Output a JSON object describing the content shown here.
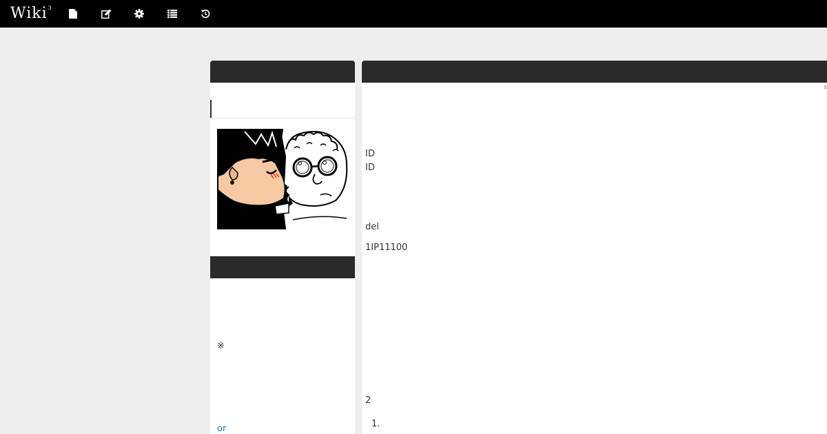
{
  "topbar": {
    "logo_text": "Wiki",
    "logo_superscript": "3",
    "icons": [
      "new-page-icon",
      "edit-icon",
      "settings-icon",
      "list-icon",
      "history-icon"
    ],
    "background": "#000000"
  },
  "sidebar": {
    "image_alt": "comic illustration of two characters",
    "note_mark": "※",
    "link_text": "or"
  },
  "main": {
    "edge_mark": "s",
    "lines": {
      "id_1": "ID",
      "id_2": "ID",
      "del": "del",
      "ip_line": "1IP11100",
      "count": "2"
    },
    "ordered_list": [
      "1."
    ]
  },
  "colors": {
    "page_background": "#eeeeee",
    "panel_header": "#2a2a2a",
    "link": "#1a7cc6"
  }
}
